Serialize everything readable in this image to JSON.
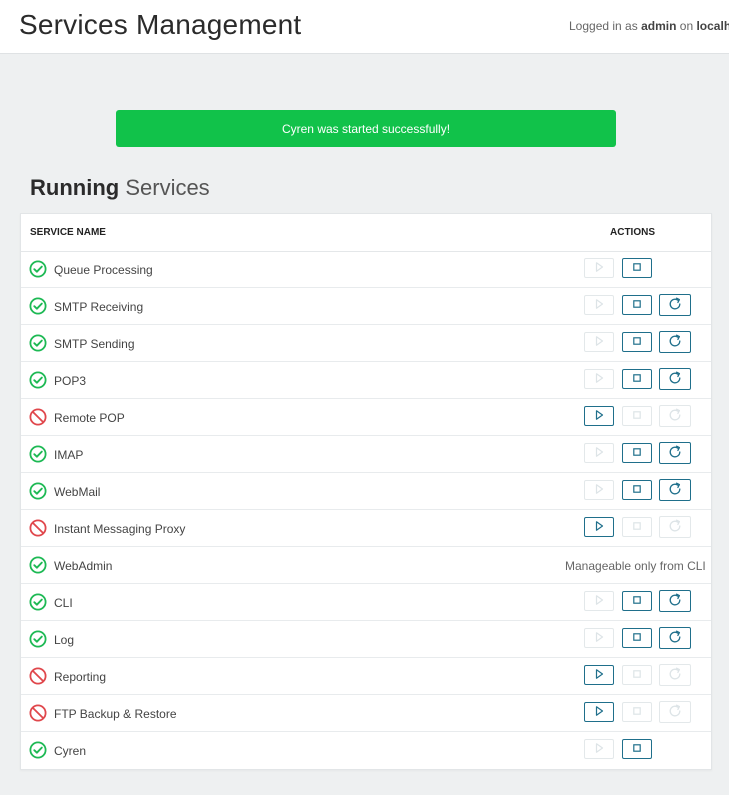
{
  "header": {
    "title": "Services Management",
    "login_prefix": "Logged in as",
    "user": "admin",
    "login_mid": "on",
    "host": "localhost"
  },
  "alert": {
    "message": "Cyren was started successfully!",
    "color": "#11c24a"
  },
  "section": {
    "title_strong": "Running",
    "title_light": "Services"
  },
  "table": {
    "col_name": "SERVICE NAME",
    "col_actions": "ACTIONS",
    "rows": [
      {
        "name": "Queue Processing",
        "status": "running",
        "start": "disabled",
        "stop": "enabled",
        "restart": "none"
      },
      {
        "name": "SMTP Receiving",
        "status": "running",
        "start": "disabled",
        "stop": "enabled",
        "restart": "enabled"
      },
      {
        "name": "SMTP Sending",
        "status": "running",
        "start": "disabled",
        "stop": "enabled",
        "restart": "enabled"
      },
      {
        "name": "POP3",
        "status": "running",
        "start": "disabled",
        "stop": "enabled",
        "restart": "enabled"
      },
      {
        "name": "Remote POP",
        "status": "stopped",
        "start": "enabled",
        "stop": "disabled",
        "restart": "disabled"
      },
      {
        "name": "IMAP",
        "status": "running",
        "start": "disabled",
        "stop": "enabled",
        "restart": "enabled"
      },
      {
        "name": "WebMail",
        "status": "running",
        "start": "disabled",
        "stop": "enabled",
        "restart": "enabled"
      },
      {
        "name": "Instant Messaging Proxy",
        "status": "stopped",
        "start": "enabled",
        "stop": "disabled",
        "restart": "disabled"
      },
      {
        "name": "WebAdmin",
        "status": "running",
        "note": "Manageable only from CLI"
      },
      {
        "name": "CLI",
        "status": "running",
        "start": "disabled",
        "stop": "enabled",
        "restart": "enabled"
      },
      {
        "name": "Log",
        "status": "running",
        "start": "disabled",
        "stop": "enabled",
        "restart": "enabled"
      },
      {
        "name": "Reporting",
        "status": "stopped",
        "start": "enabled",
        "stop": "disabled",
        "restart": "disabled"
      },
      {
        "name": "FTP Backup & Restore",
        "status": "stopped",
        "start": "enabled",
        "stop": "disabled",
        "restart": "disabled"
      },
      {
        "name": "Cyren",
        "status": "running",
        "start": "disabled",
        "stop": "enabled",
        "restart": "none"
      }
    ]
  },
  "colors": {
    "running": "#1db954",
    "stopped": "#e0474c",
    "action": "#1f6f8b",
    "action_disabled": "#dde4e7"
  },
  "icons": {
    "running": "check-circle-icon",
    "stopped": "no-entry-icon",
    "start": "play-icon",
    "stop": "stop-square-icon",
    "restart": "refresh-icon"
  }
}
